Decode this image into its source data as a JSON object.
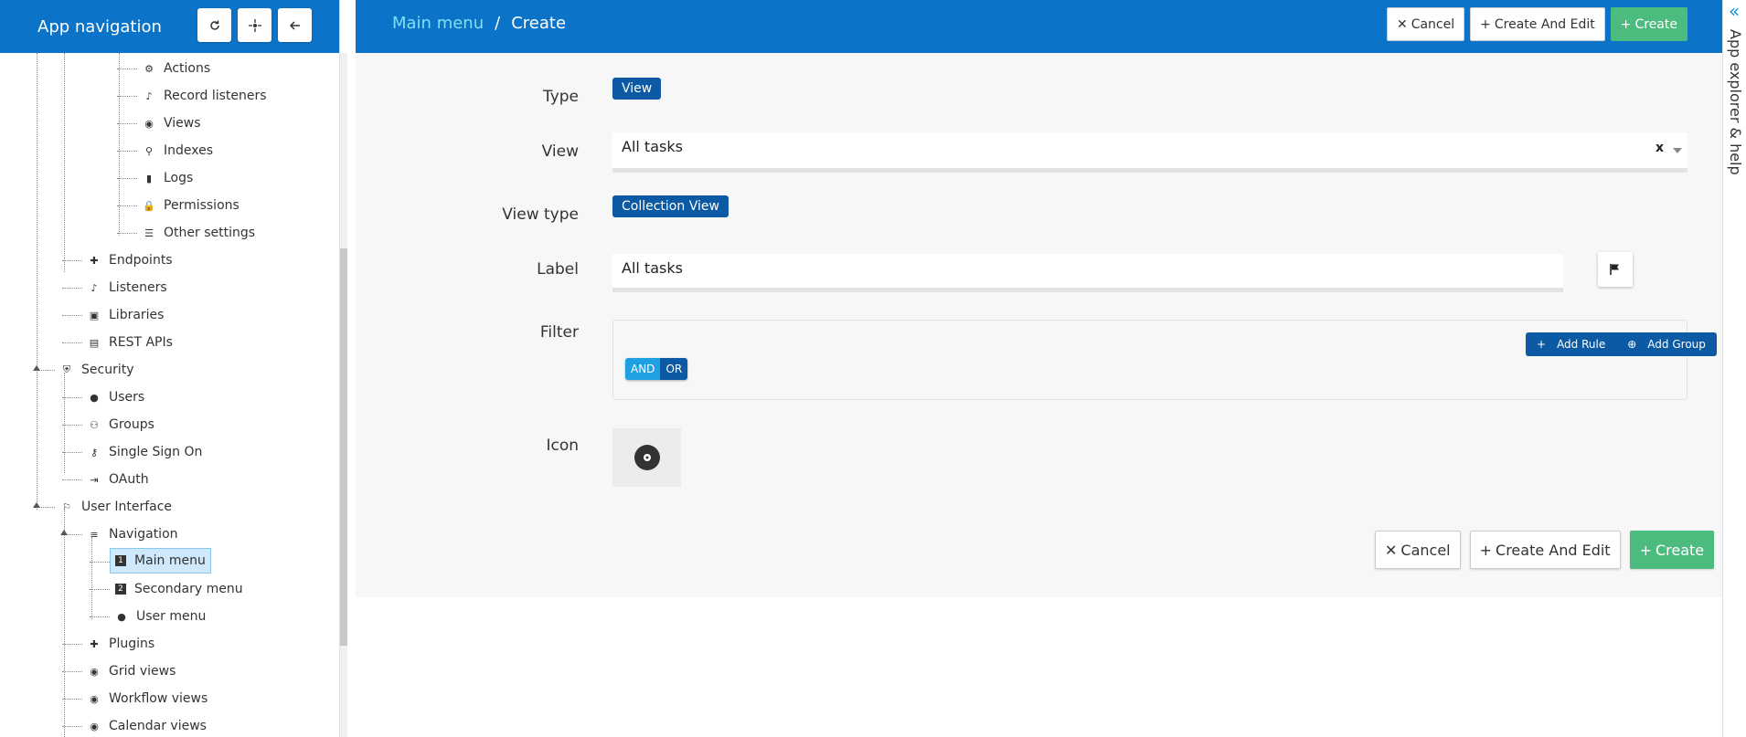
{
  "nav": {
    "title": "App navigation",
    "tools": [
      "refresh-icon",
      "crosshair-icon",
      "arrow-left-icon"
    ],
    "items": [
      {
        "label": "Actions",
        "icon": "gear-icon",
        "glyph": "⚙"
      },
      {
        "label": "Record listeners",
        "icon": "ear-icon",
        "glyph": "♪"
      },
      {
        "label": "Views",
        "icon": "eye-icon",
        "glyph": "◉"
      },
      {
        "label": "Indexes",
        "icon": "search-icon",
        "glyph": "⚲"
      },
      {
        "label": "Logs",
        "icon": "bookmark-icon",
        "glyph": "▮"
      },
      {
        "label": "Permissions",
        "icon": "lock-icon",
        "glyph": "🔒"
      },
      {
        "label": "Other settings",
        "icon": "list-icon",
        "glyph": "☰"
      },
      {
        "label": "Endpoints",
        "icon": "puzzle-icon",
        "glyph": "✚"
      },
      {
        "label": "Listeners",
        "icon": "ear-icon",
        "glyph": "♪"
      },
      {
        "label": "Libraries",
        "icon": "box-icon",
        "glyph": "▣"
      },
      {
        "label": "REST APIs",
        "icon": "api-icon",
        "glyph": "▤"
      },
      {
        "label": "Security",
        "icon": "shield-icon",
        "glyph": "⛨"
      },
      {
        "label": "Users",
        "icon": "user-circle-icon",
        "glyph": "●"
      },
      {
        "label": "Groups",
        "icon": "group-icon",
        "glyph": "⚇"
      },
      {
        "label": "Single Sign On",
        "icon": "key-icon",
        "glyph": "⚷"
      },
      {
        "label": "OAuth",
        "icon": "login-icon",
        "glyph": "⇥"
      },
      {
        "label": "User Interface",
        "icon": "ui-icon",
        "glyph": "⚐"
      },
      {
        "label": "Navigation",
        "icon": "menu-icon",
        "glyph": "≡"
      },
      {
        "label": "Main menu",
        "icon": "number-1-icon",
        "glyph": "1"
      },
      {
        "label": "Secondary menu",
        "icon": "number-2-icon",
        "glyph": "2"
      },
      {
        "label": "User menu",
        "icon": "user-circle-icon",
        "glyph": "●"
      },
      {
        "label": "Plugins",
        "icon": "puzzle-icon",
        "glyph": "✚"
      },
      {
        "label": "Grid views",
        "icon": "eye-icon",
        "glyph": "◉"
      },
      {
        "label": "Workflow views",
        "icon": "eye-icon",
        "glyph": "◉"
      },
      {
        "label": "Calendar views",
        "icon": "eye-icon",
        "glyph": "◉"
      }
    ]
  },
  "header": {
    "breadcrumb_link": "Main menu",
    "breadcrumb_sep": "/",
    "breadcrumb_current": "Create",
    "cancel": "Cancel",
    "create_and_edit": "Create And Edit",
    "create": "Create"
  },
  "form": {
    "type_label": "Type",
    "type_value": "View",
    "view_label": "View",
    "view_value": "All tasks",
    "view_clear": "x",
    "view_type_label": "View type",
    "view_type_value": "Collection View",
    "label_label": "Label",
    "label_value": "All tasks",
    "filter_label": "Filter",
    "and": "AND",
    "or": "OR",
    "add_rule": "Add Rule",
    "add_group": "Add Group",
    "icon_label": "Icon"
  },
  "footer": {
    "cancel": "Cancel",
    "create_and_edit": "Create And Edit",
    "create": "Create"
  },
  "right_panel": {
    "label": "App explorer & help"
  },
  "colors": {
    "brand_blue": "#0b74c9",
    "tag_blue": "#0b5aa3",
    "create_green": "#4cbb7e",
    "selected_bg": "#cfe8fb"
  }
}
